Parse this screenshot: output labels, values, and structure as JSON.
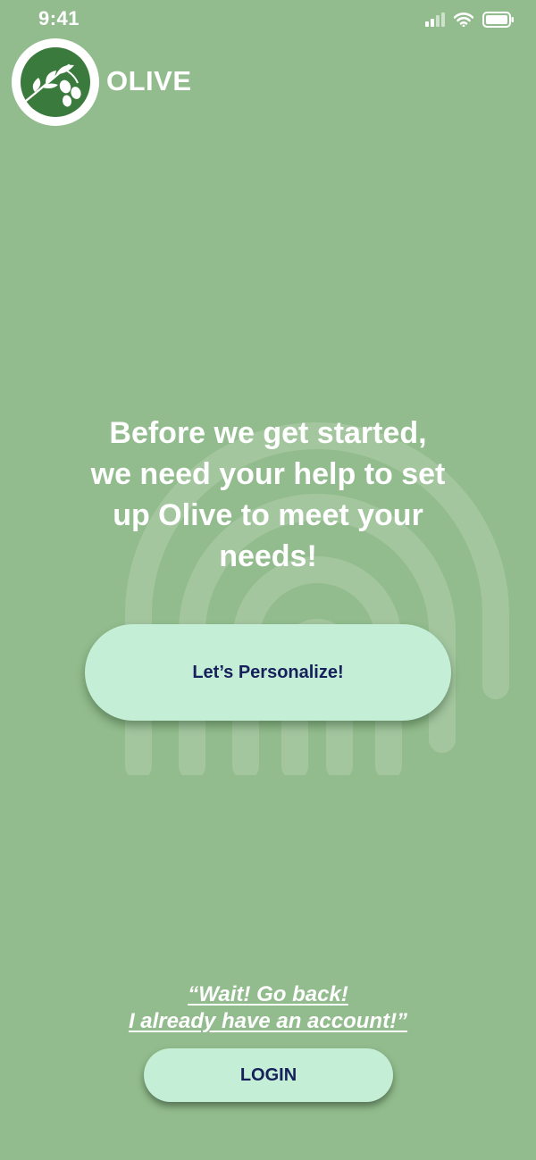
{
  "theme": {
    "background": "#92bc8d",
    "button_fill": "#c5eed7",
    "button_text": "#16205a",
    "logo_circle": "#3b7a3d",
    "text": "#ffffff"
  },
  "status_bar": {
    "time": "9:41",
    "icons": [
      "cellular-signal-icon",
      "wifi-icon",
      "battery-icon"
    ]
  },
  "brand": {
    "name": "OLIVE",
    "logo_icon": "olive-branch-icon"
  },
  "welcome": {
    "headline_lines": [
      "Before we get started,",
      "we need your help to set",
      "up Olive to meet your",
      "needs!"
    ],
    "background_icon": "fingerprint-icon"
  },
  "actions": {
    "personalize_label": "Let’s Personalize!",
    "back_link_lines": [
      "“Wait! Go back!",
      "I already have an account!”"
    ],
    "login_label": "LOGIN"
  }
}
